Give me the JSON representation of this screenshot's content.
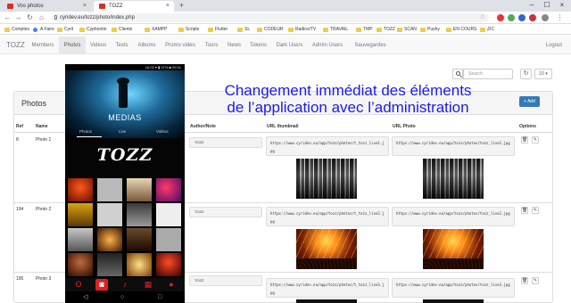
{
  "browser": {
    "tabs": [
      {
        "title": "Vos photos",
        "close": "×"
      },
      {
        "title": "TOZZ",
        "close": "×"
      }
    ],
    "new_tab": "+",
    "window_controls": [
      "–",
      "☐",
      "×"
    ],
    "nav": {
      "back": "←",
      "forward": "→",
      "reload": "↻",
      "home": "⌂"
    },
    "url": "cyridev.eu/tozz/photo/index.php",
    "bookmarks": [
      "Comptes",
      "A Faire",
      "Cyril",
      "Cyphontin",
      "Clients",
      "XAMPP",
      "Scripts",
      "Flutter",
      "SL",
      "CODEUR",
      "Radios/TV",
      "TRAVAIL",
      "TMP",
      "TOZZ",
      "SCAN",
      "Pushy",
      "EN COURS",
      "ZIC"
    ],
    "bookmark_types": [
      "folder",
      "site",
      "folder",
      "folder",
      "folder",
      "folder",
      "folder",
      "folder",
      "folder",
      "folder",
      "folder",
      "folder",
      "folder",
      "folder",
      "folder",
      "folder",
      "folder",
      "folder"
    ]
  },
  "navbar": {
    "brand": "TOZZ",
    "items": [
      "Members",
      "Photos",
      "Videos",
      "Texts",
      "Albums",
      "Promo video",
      "Tours",
      "News",
      "Tokens",
      "Dark Users",
      "Admin Users",
      "Sauvegardes"
    ],
    "active": "Photos",
    "logout": "Logout"
  },
  "toolbar": {
    "search_placeholder": "Search",
    "refresh": "↻",
    "per_page": "10 ▾"
  },
  "panel": {
    "title": "Photos",
    "add_button": "+ Add"
  },
  "table": {
    "headers": [
      "Ref",
      "Name",
      "Author/Note",
      "URL thumbnail",
      "URL Photo",
      "Options"
    ],
    "rows": [
      {
        "ref": "8",
        "name": "Photo 1",
        "author": "TOZZ",
        "url_thumb": "https://www.cyridev.eu/app/tozz/photos/t_tozz_live1.jpg",
        "url_photo": "https://www.cyridev.eu/app/tozz/photos/tozz_live1.jpg"
      },
      {
        "ref": "194",
        "name": "Photo 2",
        "author": "TOZZ",
        "url_thumb": "https://www.cyridev.eu/app/tozz/photos/t_tozz_live2.jpg",
        "url_photo": "https://www.cyridev.eu/app/tozz/photos/tozz_live2.jpg"
      },
      {
        "ref": "195",
        "name": "Photo 3",
        "author": "TOZZ",
        "url_thumb": "https://www.cyridev.eu/app/tozz/photos/t_tozz_live3.jpg",
        "url_photo": "https://www.cyridev.eu/app/tozz/photos/tozz_live3.jpg"
      }
    ],
    "option_icons": [
      "trash-icon",
      "edit-icon"
    ]
  },
  "caption": {
    "line1": "Changement immédiat des éléments",
    "line2": "de l’application avec l’administration"
  },
  "phone": {
    "status_text": "16:02 ▾ ▮ 57% ■ 09:31",
    "hero_title": "MEDIAS",
    "tabs": [
      "Photos",
      "Live",
      "Vidéos"
    ],
    "logo": "TOZZ",
    "bottom_nav_icons": [
      "o-icon",
      "camera-icon",
      "music-note-icon",
      "calendar-icon",
      "dot-icon"
    ],
    "sys_nav": [
      "◁",
      "○",
      "□"
    ]
  },
  "colors": {
    "caption": "#1a1aee",
    "add_button": "#337ab7",
    "phone_accent": "#e02020"
  }
}
